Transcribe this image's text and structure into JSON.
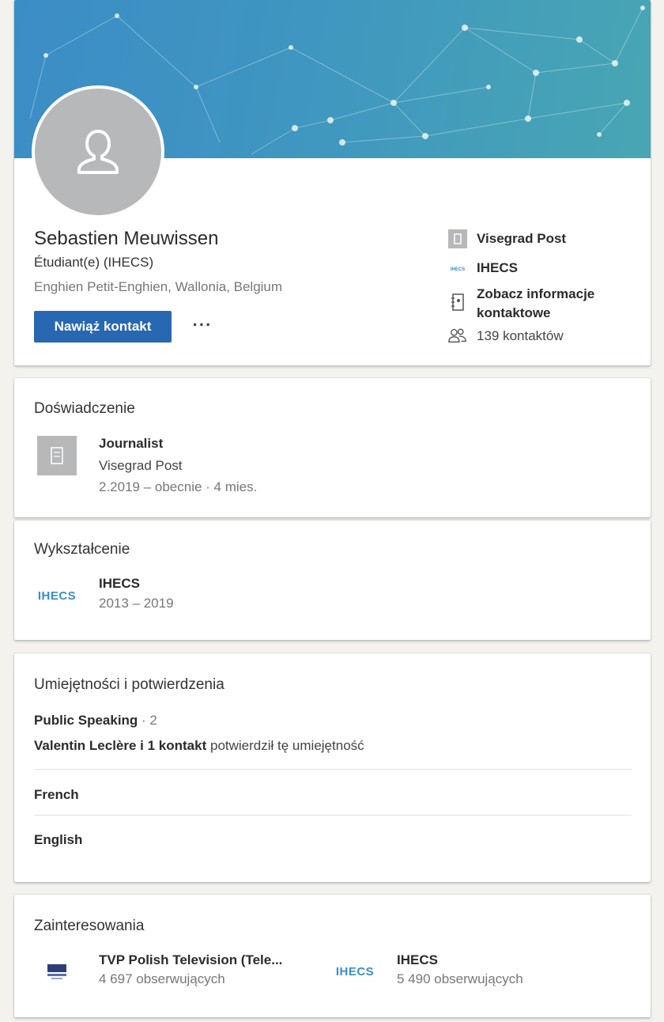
{
  "profile": {
    "name": "Sebastien Meuwissen",
    "headline": "Étudiant(e) (IHECS)",
    "location": "Enghien Petit-Enghien, Wallonia, Belgium",
    "connect_label": "Nawiąż kontakt",
    "more_label": "···",
    "current_company": "Visegrad Post",
    "school": "IHECS",
    "contact_info_label": "Zobacz informacje kontaktowe",
    "connections": "139 kontaktów"
  },
  "experience": {
    "title": "Doświadczenie",
    "role": "Journalist",
    "company": "Visegrad Post",
    "dates": "2.2019 – obecnie · 4 mies."
  },
  "education": {
    "title": "Wykształcenie",
    "school": "IHECS",
    "dates": "2013 – 2019",
    "logo_text": "IHECS"
  },
  "skills": {
    "title": "Umiejętności i potwierdzenia",
    "items": [
      {
        "name": "Public Speaking",
        "count": "· 2",
        "endorsers": "Valentin Leclère i 1 kontakt",
        "endorse_text": "potwierdził tę umiejętność"
      },
      {
        "name": "French"
      },
      {
        "name": "English"
      }
    ]
  },
  "interests": {
    "title": "Zainteresowania",
    "items": [
      {
        "name": "TVP Polish Television (Tele...",
        "followers": "4 697 obserwujących"
      },
      {
        "name": "IHECS",
        "followers": "5 490 obserwujących",
        "logo_text": "IHECS"
      }
    ]
  },
  "colors": {
    "accent": "#2867b2",
    "banner_start": "#3b8dc6",
    "banner_end": "#48a6b3"
  }
}
